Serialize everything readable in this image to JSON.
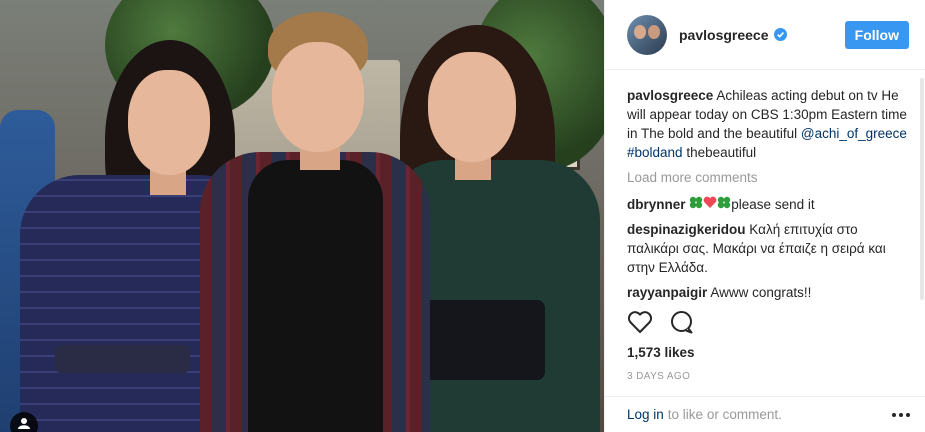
{
  "post": {
    "username": "pavlosgreece",
    "follow_label": "Follow",
    "caption": {
      "username": "pavlosgreece",
      "text": "Achileas acting debut on tv He will appear today on CBS 1:30pm Eastern time in The bold and the beautiful",
      "mention": "@achi_of_greece",
      "hashtag": "#boldand",
      "tail": "thebeautiful"
    },
    "load_more_label": "Load more comments",
    "comments": [
      {
        "username": "dbrynner",
        "text": "please send it",
        "emoji": [
          "shamrock",
          "heart",
          "shamrock"
        ]
      },
      {
        "username": "despinazigkeridou",
        "text": "Καλή επιτυχία στο παλικάρι σας. Μακάρι να έπαιζε η σειρά και στην Ελλάδα."
      },
      {
        "username": "rayyanpaigir",
        "text": "Awww congrats!!"
      }
    ],
    "likes": "1,573 likes",
    "date": "3 DAYS AGO",
    "footer": {
      "login": "Log in",
      "rest": "to like or comment."
    },
    "colors": {
      "accent": "#3897f0",
      "link": "#003569",
      "heart": "#ed4956",
      "shamrock": "#2e9d3c"
    }
  }
}
